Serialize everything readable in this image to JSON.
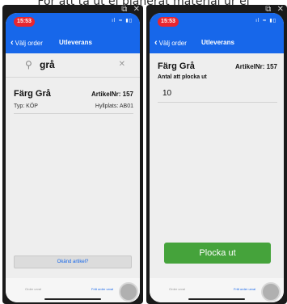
{
  "caption": "För att ta ut ej planerat material ur ej",
  "window_controls": [
    "⧉",
    "✕"
  ],
  "status": {
    "time": "15:53",
    "icons": "ıl ≈ ▮▯"
  },
  "nav": {
    "back_label": "Välj order",
    "title": "Utleverans"
  },
  "left_screen": {
    "search": {
      "icon": "search-icon",
      "value": "grå",
      "clear": "✕"
    },
    "item": {
      "title": "Färg Grå",
      "article_nr": "ArtikelNr: 157",
      "type": "Typ: KÖP",
      "shelf": "Hyllplats: AB01"
    },
    "unknown_button": "Okänd artikel?"
  },
  "right_screen": {
    "item": {
      "title": "Färg Grå",
      "article_nr": "ArtikelNr: 157"
    },
    "quantity_label": "Antal att plocka ut",
    "quantity_value": "10",
    "primary_button": "Plocka ut"
  },
  "bottom_tabs": {
    "left": "Order urval",
    "right": "Fritt order urval"
  },
  "colors": {
    "accent": "#1767ea",
    "primary": "#45a33b",
    "time_pill": "#e8262f"
  }
}
